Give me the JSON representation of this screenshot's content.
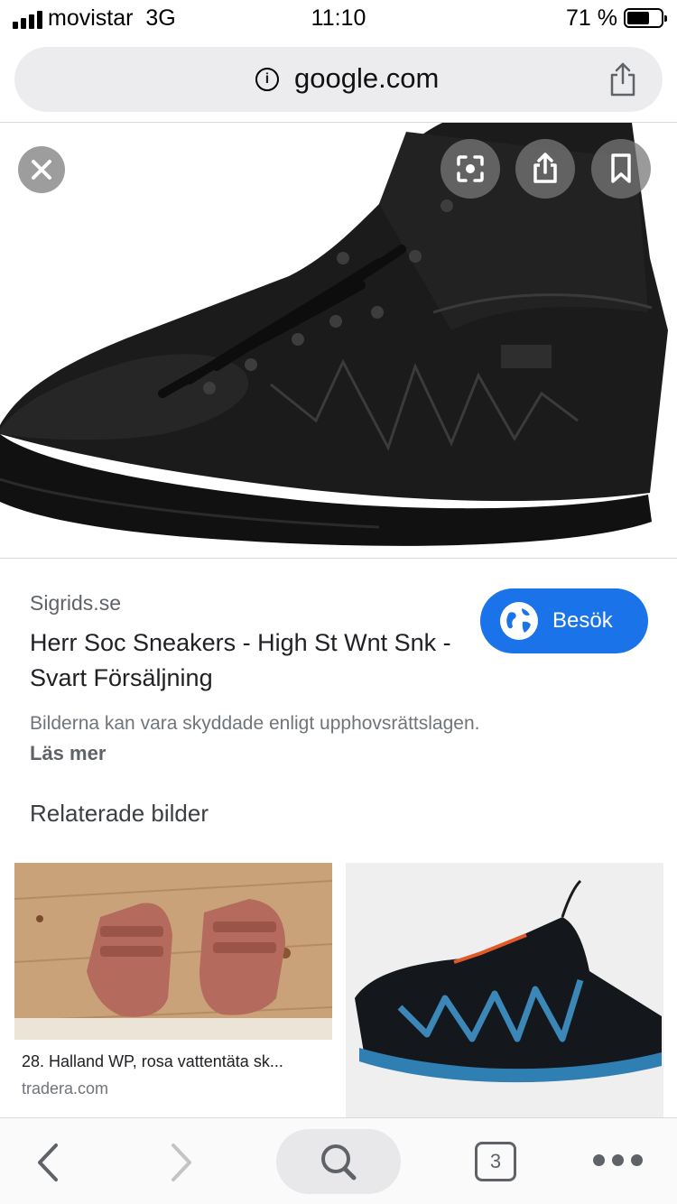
{
  "status_bar": {
    "carrier": "movistar",
    "network": "3G",
    "time": "11:10",
    "battery_percent": "71 %",
    "battery_level": 0.71
  },
  "url_bar": {
    "domain": "google.com",
    "info_icon": "info-icon",
    "share_icon": "share-icon"
  },
  "hero": {
    "close_icon": "close-icon",
    "actions": [
      {
        "name": "lens",
        "icon": "lens-icon"
      },
      {
        "name": "share",
        "icon": "share-icon"
      },
      {
        "name": "bookmark",
        "icon": "bookmark-icon"
      }
    ]
  },
  "result": {
    "site": "Sigrids.se",
    "title": "Herr Soc Sneakers - High St Wnt Snk - Svart Försäljning",
    "visit_label": "Besök",
    "copyright_notice": "Bilderna kan vara skyddade enligt upphovsrättslagen.",
    "read_more": "Läs mer"
  },
  "related": {
    "heading": "Relaterade bilder",
    "items": [
      {
        "caption": "28. Halland WP, rosa vattentäta sk...",
        "source": "tradera.com"
      },
      {
        "caption": "",
        "source": ""
      }
    ]
  },
  "toolbar": {
    "tab_count": "3"
  },
  "colors": {
    "accent": "#1a73e8",
    "toolbar_icon": "#5f6368",
    "url_bar_bg": "#ececee"
  }
}
